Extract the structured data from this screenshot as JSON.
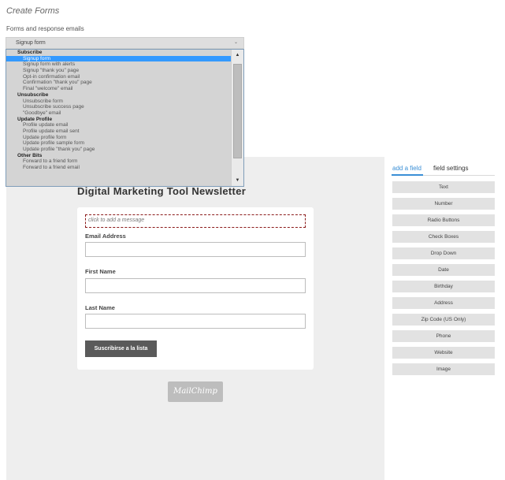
{
  "header": {
    "title": "Create Forms",
    "subtitle": "Forms and response emails"
  },
  "form_select": {
    "selected": "Signup form",
    "icon": "chevron-down-icon"
  },
  "dropdown": {
    "rows": [
      {
        "type": "group",
        "label": "Subscribe"
      },
      {
        "type": "option",
        "label": "Signup form",
        "selected": true
      },
      {
        "type": "option",
        "label": "Signup form with alerts"
      },
      {
        "type": "option",
        "label": "Signup \"thank you\" page"
      },
      {
        "type": "option",
        "label": "Opt-in confirmation email"
      },
      {
        "type": "option",
        "label": "Confirmation \"thank you\" page"
      },
      {
        "type": "option",
        "label": "Final \"welcome\" email"
      },
      {
        "type": "group",
        "label": "Unsubscribe"
      },
      {
        "type": "option",
        "label": "Unsubscribe form"
      },
      {
        "type": "option",
        "label": "Unsubscribe success page"
      },
      {
        "type": "option",
        "label": "\"Goodbye\" email"
      },
      {
        "type": "group",
        "label": "Update Profile"
      },
      {
        "type": "option",
        "label": "Profile update email"
      },
      {
        "type": "option",
        "label": "Profile update email sent"
      },
      {
        "type": "option",
        "label": "Update profile form"
      },
      {
        "type": "option",
        "label": "Update profile sample form"
      },
      {
        "type": "option",
        "label": "Update profile \"thank you\" page"
      },
      {
        "type": "group",
        "label": "Other Bits"
      },
      {
        "type": "option",
        "label": "Forward to a friend form"
      },
      {
        "type": "option",
        "label": "Forward to a friend email"
      }
    ],
    "scroll_up_icon": "▲",
    "scroll_down_icon": "▼"
  },
  "preview": {
    "newsletter_title": "Digital Marketing Tool Newsletter",
    "message_placeholder": "click to add a message",
    "fields": [
      {
        "label": "Email Address",
        "value": ""
      },
      {
        "label": "First Name",
        "value": ""
      },
      {
        "label": "Last Name",
        "value": ""
      }
    ],
    "submit_label": "Suscribirse a la lista",
    "logo_text": "MailChimp"
  },
  "sidebar": {
    "tabs": [
      {
        "label": "add a field",
        "active": true
      },
      {
        "label": "field settings",
        "active": false
      }
    ],
    "field_types": [
      "Text",
      "Number",
      "Radio Buttons",
      "Check Boxes",
      "Drop Down",
      "Date",
      "Birthday",
      "Address",
      "Zip Code (US Only)",
      "Phone",
      "Website",
      "Image"
    ]
  },
  "colors": {
    "accent": "#3a8fd6",
    "selection": "#3399ff",
    "message_border": "#8b1a1a",
    "submit_bg": "#5a5a5a"
  }
}
